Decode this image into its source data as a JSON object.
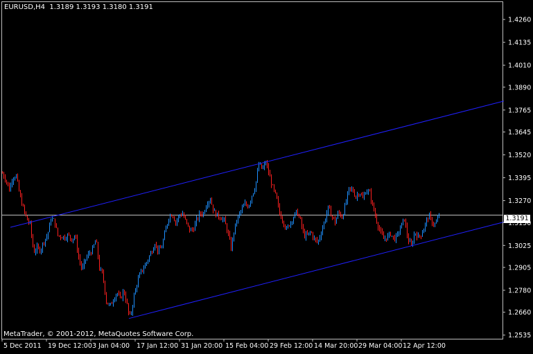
{
  "window": {
    "symbol": "EURUSD,H4",
    "ohlc": "1.3189 1.3193 1.3180 1.3191",
    "copyright": "MetaTrader, © 2001-2012, MetaQuotes Software Corp.",
    "current_price_label": "1.3191"
  },
  "colors": {
    "background": "#000000",
    "bull": "#1e90ff",
    "bear": "#ff2020",
    "channel": "#2020ff",
    "grid": "#c0c0c0",
    "text": "#ffffff"
  },
  "chart_data": {
    "type": "candlestick",
    "y_ticks": [
      "1.4260",
      "1.4135",
      "1.4010",
      "1.3890",
      "1.3765",
      "1.3645",
      "1.3520",
      "1.3395",
      "1.3270",
      "1.3150",
      "1.3025",
      "1.2905",
      "1.2780",
      "1.2660",
      "1.2535"
    ],
    "x_ticks": [
      "5 Dec 2011",
      "19 Dec 12:00",
      "3 Jan 04:00",
      "17 Jan 12:00",
      "31 Jan 20:00",
      "15 Feb 04:00",
      "29 Feb 12:00",
      "14 Mar 20:00",
      "29 Mar 04:00",
      "12 Apr 12:00"
    ],
    "ylim": [
      1.2515,
      1.4355
    ],
    "current_price": 1.3191,
    "price_path": [
      [
        0,
        1.342
      ],
      [
        5,
        1.3385
      ],
      [
        10,
        1.333
      ],
      [
        15,
        1.34
      ],
      [
        20,
        1.3405
      ],
      [
        25,
        1.33
      ],
      [
        30,
        1.323
      ],
      [
        35,
        1.317
      ],
      [
        40,
        1.314
      ],
      [
        45,
        1.299
      ],
      [
        50,
        1.301
      ],
      [
        55,
        1.3
      ],
      [
        60,
        1.305
      ],
      [
        65,
        1.308
      ],
      [
        70,
        1.317
      ],
      [
        75,
        1.316
      ],
      [
        80,
        1.308
      ],
      [
        85,
        1.3075
      ],
      [
        90,
        1.307
      ],
      [
        95,
        1.308
      ],
      [
        100,
        1.306
      ],
      [
        105,
        1.308
      ],
      [
        110,
        1.296
      ],
      [
        115,
        1.289
      ],
      [
        120,
        1.295
      ],
      [
        125,
        1.298
      ],
      [
        130,
        1.3
      ],
      [
        135,
        1.306
      ],
      [
        140,
        1.29
      ],
      [
        145,
        1.286
      ],
      [
        150,
        1.272
      ],
      [
        155,
        1.269
      ],
      [
        160,
        1.273
      ],
      [
        165,
        1.277
      ],
      [
        170,
        1.273
      ],
      [
        175,
        1.278
      ],
      [
        180,
        1.27
      ],
      [
        183,
        1.263
      ],
      [
        186,
        1.266
      ],
      [
        190,
        1.275
      ],
      [
        195,
        1.283
      ],
      [
        200,
        1.288
      ],
      [
        205,
        1.291
      ],
      [
        210,
        1.295
      ],
      [
        215,
        1.299
      ],
      [
        220,
        1.304
      ],
      [
        225,
        1.299
      ],
      [
        230,
        1.302
      ],
      [
        235,
        1.31
      ],
      [
        240,
        1.318
      ],
      [
        245,
        1.32
      ],
      [
        250,
        1.315
      ],
      [
        255,
        1.319
      ],
      [
        260,
        1.32
      ],
      [
        265,
        1.315
      ],
      [
        270,
        1.311
      ],
      [
        275,
        1.311
      ],
      [
        280,
        1.316
      ],
      [
        285,
        1.32
      ],
      [
        290,
        1.32
      ],
      [
        295,
        1.326
      ],
      [
        300,
        1.328
      ],
      [
        305,
        1.321
      ],
      [
        310,
        1.319
      ],
      [
        315,
        1.318
      ],
      [
        320,
        1.316
      ],
      [
        325,
        1.31
      ],
      [
        330,
        1.301
      ],
      [
        335,
        1.312
      ],
      [
        340,
        1.318
      ],
      [
        345,
        1.322
      ],
      [
        350,
        1.325
      ],
      [
        355,
        1.324
      ],
      [
        360,
        1.33
      ],
      [
        365,
        1.335
      ],
      [
        370,
        1.347
      ],
      [
        375,
        1.344
      ],
      [
        380,
        1.348
      ],
      [
        385,
        1.341
      ],
      [
        390,
        1.334
      ],
      [
        395,
        1.329
      ],
      [
        400,
        1.32
      ],
      [
        405,
        1.316
      ],
      [
        410,
        1.311
      ],
      [
        415,
        1.315
      ],
      [
        420,
        1.318
      ],
      [
        425,
        1.321
      ],
      [
        430,
        1.316
      ],
      [
        435,
        1.308
      ],
      [
        440,
        1.308
      ],
      [
        445,
        1.31
      ],
      [
        450,
        1.306
      ],
      [
        455,
        1.304
      ],
      [
        460,
        1.31
      ],
      [
        465,
        1.316
      ],
      [
        470,
        1.323
      ],
      [
        475,
        1.319
      ],
      [
        480,
        1.315
      ],
      [
        485,
        1.321
      ],
      [
        490,
        1.318
      ],
      [
        495,
        1.325
      ],
      [
        500,
        1.333
      ],
      [
        505,
        1.333
      ],
      [
        510,
        1.329
      ],
      [
        515,
        1.332
      ],
      [
        520,
        1.328
      ],
      [
        525,
        1.333
      ],
      [
        530,
        1.331
      ],
      [
        535,
        1.323
      ],
      [
        540,
        1.316
      ],
      [
        545,
        1.31
      ],
      [
        550,
        1.306
      ],
      [
        555,
        1.307
      ],
      [
        560,
        1.309
      ],
      [
        565,
        1.306
      ],
      [
        570,
        1.308
      ],
      [
        575,
        1.313
      ],
      [
        580,
        1.317
      ],
      [
        585,
        1.306
      ],
      [
        590,
        1.302
      ],
      [
        595,
        1.31
      ],
      [
        600,
        1.307
      ],
      [
        605,
        1.309
      ],
      [
        610,
        1.314
      ],
      [
        615,
        1.319
      ],
      [
        620,
        1.315
      ],
      [
        625,
        1.314
      ],
      [
        630,
        1.3191
      ]
    ],
    "channel_lines": [
      {
        "from": [
          12,
          1.3124
        ],
        "to": [
          724,
          1.3814
        ]
      },
      {
        "from": [
          183,
          1.2626
        ],
        "to": [
          724,
          1.3153
        ]
      }
    ]
  }
}
